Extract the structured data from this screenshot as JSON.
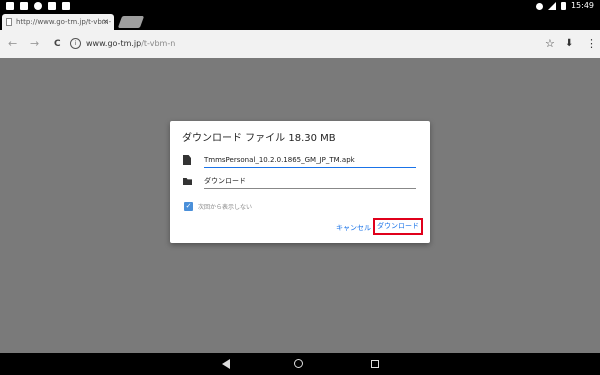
{
  "status_bar": {
    "left_icons": [
      "expand-icon",
      "image-icon",
      "location-icon",
      "screenshot-icon",
      "play-store-icon"
    ],
    "right_icons": [
      "dnd-icon",
      "wifi-icon",
      "battery-icon"
    ],
    "time": "15:49"
  },
  "tab": {
    "title": "http://www.go-tm.jp/t-vbm-",
    "close": "×"
  },
  "toolbar": {
    "back": "←",
    "forward": "→",
    "reload": "C",
    "info": "i",
    "url_host": "www.go-tm.jp",
    "url_path": "/t-vbm-n",
    "star": "☆",
    "download": "⬇",
    "menu": "⋮"
  },
  "dialog": {
    "title": "ダウンロード ファイル 18.30 MB",
    "filename": "TmmsPersonal_10.2.0.1865_GM_JP_TM.apk",
    "folder": "ダウンロード",
    "checkbox_checked": true,
    "checkbox_label": "次回から表示しない",
    "cancel_label": "キャンセル",
    "download_label": "ダウンロード"
  },
  "colors": {
    "accent": "#1a73e8",
    "highlight_box": "#e0001b"
  }
}
